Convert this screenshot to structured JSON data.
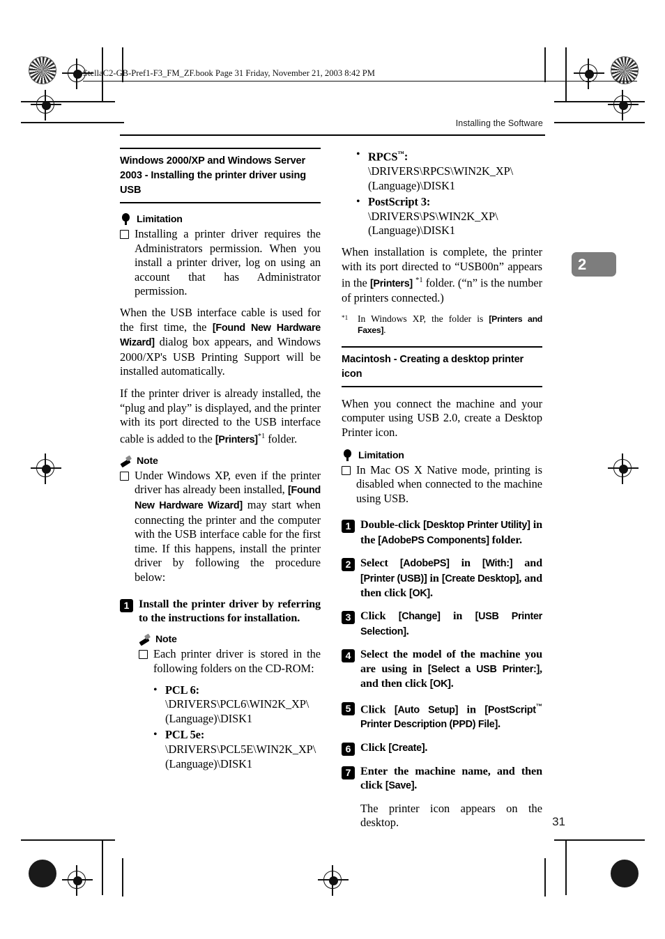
{
  "file_header": "StellaC2-GB-Pref1-F3_FM_ZF.book  Page 31  Friday, November 21, 2003  8:42 PM",
  "running_head": "Installing the Software",
  "chapter_tab": "2",
  "page_number": "31",
  "left_column": {
    "section_heading": "Windows 2000/XP and Windows Server 2003 - Installing the printer driver using USB",
    "limitation_label": "Limitation",
    "limitation_items": [
      "Installing a printer driver requires the Administrators permission. When you install a printer driver, log on using an account that has Administrator permission."
    ],
    "para_usb_first_time": {
      "part1": "When the USB interface cable is used for the first time, the ",
      "ui1": "[Found New Hardware Wizard]",
      "part2": " dialog box appears, and Windows 2000/XP's USB Printing Support will be installed automatically."
    },
    "para_already_installed": {
      "part1": "If the printer driver is already installed, the “plug and play” is displayed, and the printer with its port directed to the USB interface cable is added to the ",
      "ui1": "[Printers]",
      "footnote_mark": "*1",
      "part2": " folder."
    },
    "note_label": "Note",
    "note_xp": {
      "part1": "Under Windows XP, even if the printer driver has already been installed, ",
      "ui1": "[Found New Hardware Wizard]",
      "part2": " may start when connecting the printer and the computer with the USB interface cable for the first time. If this happens, install the printer driver by following the procedure below:"
    },
    "step1": "Install the printer driver by referring to the instructions for installation.",
    "note_label_2": "Note",
    "note_folders": "Each printer driver is stored in the following folders on the CD-ROM:",
    "driver_paths": [
      {
        "name": "PCL 6:",
        "path": "\\DRIVERS\\PCL6\\WIN2K_XP\\(Language)\\DISK1"
      },
      {
        "name": "PCL 5e:",
        "path": "\\DRIVERS\\PCL5E\\WIN2K_XP\\(Language)\\DISK1"
      }
    ]
  },
  "right_column": {
    "driver_paths": [
      {
        "name": "RPCS",
        "tm": "™",
        "suffix": ":",
        "path": "\\DRIVERS\\RPCS\\WIN2K_XP\\(Language)\\DISK1"
      },
      {
        "name": "PostScript 3:",
        "tm": "",
        "suffix": "",
        "path": "\\DRIVERS\\PS\\WIN2K_XP\\(Language)\\DISK1"
      }
    ],
    "para_complete": {
      "part1": "When installation is complete, the printer with its port directed to “USB00n” appears in the ",
      "ui1": "[Printers]",
      "footnote_mark": "*1",
      "part2": " folder. (“n” is the number of printers connected.)"
    },
    "footnote": {
      "mark": "*1",
      "part1": "In Windows XP, the folder is ",
      "ui1": "[Printers and Faxes]",
      "part2": "."
    },
    "section_heading": "Macintosh - Creating a desktop printer icon",
    "para_intro": "When you connect the machine and your computer using USB 2.0, create a Desktop Printer icon.",
    "limitation_label": "Limitation",
    "limitation_items": [
      "In Mac OS X Native mode, printing is disabled when connected to the machine using USB."
    ],
    "steps": [
      {
        "num": "1",
        "parts": [
          {
            "t": "serif",
            "v": "Double-click "
          },
          {
            "t": "ui",
            "v": "[Desktop Printer Utility]"
          },
          {
            "t": "serif",
            "v": " in the "
          },
          {
            "t": "ui",
            "v": "[AdobePS Components]"
          },
          {
            "t": "serif",
            "v": " folder."
          }
        ]
      },
      {
        "num": "2",
        "parts": [
          {
            "t": "serif",
            "v": "Select "
          },
          {
            "t": "ui",
            "v": "[AdobePS]"
          },
          {
            "t": "serif",
            "v": " in "
          },
          {
            "t": "ui",
            "v": "[With:]"
          },
          {
            "t": "serif",
            "v": " and "
          },
          {
            "t": "ui",
            "v": "[Printer (USB)]"
          },
          {
            "t": "serif",
            "v": " in "
          },
          {
            "t": "ui",
            "v": "[Create Desktop]"
          },
          {
            "t": "serif",
            "v": ", and then click "
          },
          {
            "t": "ui",
            "v": "[OK]"
          },
          {
            "t": "serif",
            "v": "."
          }
        ]
      },
      {
        "num": "3",
        "parts": [
          {
            "t": "serif",
            "v": "Click "
          },
          {
            "t": "ui",
            "v": "[Change]"
          },
          {
            "t": "serif",
            "v": " in "
          },
          {
            "t": "ui",
            "v": "[USB Printer Selection]"
          },
          {
            "t": "serif",
            "v": "."
          }
        ]
      },
      {
        "num": "4",
        "parts": [
          {
            "t": "serif",
            "v": "Select the model of the machine you are using in "
          },
          {
            "t": "ui",
            "v": "[Select a USB Printer:]"
          },
          {
            "t": "serif",
            "v": ", and then click "
          },
          {
            "t": "ui",
            "v": "[OK]"
          },
          {
            "t": "serif",
            "v": "."
          }
        ]
      },
      {
        "num": "5",
        "parts": [
          {
            "t": "serif",
            "v": "Click "
          },
          {
            "t": "ui",
            "v": "[Auto Setup]"
          },
          {
            "t": "serif",
            "v": " in "
          },
          {
            "t": "ui-tm",
            "v": "[PostScript"
          },
          {
            "t": "sup",
            "v": "™"
          },
          {
            "t": "ui",
            "v": " Printer Description (PPD) File]"
          },
          {
            "t": "serif",
            "v": "."
          }
        ]
      },
      {
        "num": "6",
        "parts": [
          {
            "t": "serif",
            "v": "Click "
          },
          {
            "t": "ui",
            "v": "[Create]"
          },
          {
            "t": "serif",
            "v": "."
          }
        ]
      },
      {
        "num": "7",
        "parts": [
          {
            "t": "serif",
            "v": "Enter the machine name, and then click "
          },
          {
            "t": "ui",
            "v": "[Save]"
          },
          {
            "t": "serif",
            "v": "."
          }
        ]
      }
    ],
    "step7_result": "The printer icon appears on the desktop."
  }
}
